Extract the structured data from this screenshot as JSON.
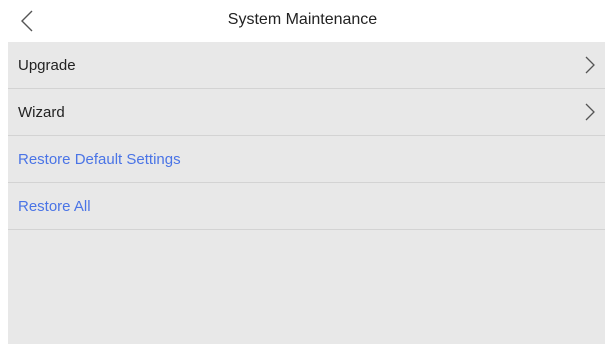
{
  "header": {
    "title": "System Maintenance",
    "back_icon": "chevron-left-icon"
  },
  "menu": {
    "items": [
      {
        "label": "Upgrade",
        "icon": "chevron-right-icon",
        "color": "#222222"
      },
      {
        "label": "Wizard",
        "icon": "chevron-right-icon",
        "color": "#222222"
      },
      {
        "label": "Restore Default Settings",
        "color": "#4a74e6"
      },
      {
        "label": "Restore All",
        "color": "#4a74e6"
      }
    ]
  },
  "colors": {
    "panel_background": "#e8e8e8",
    "divider": "#d3d3d3",
    "action_text": "#4a74e6",
    "text": "#222222"
  }
}
